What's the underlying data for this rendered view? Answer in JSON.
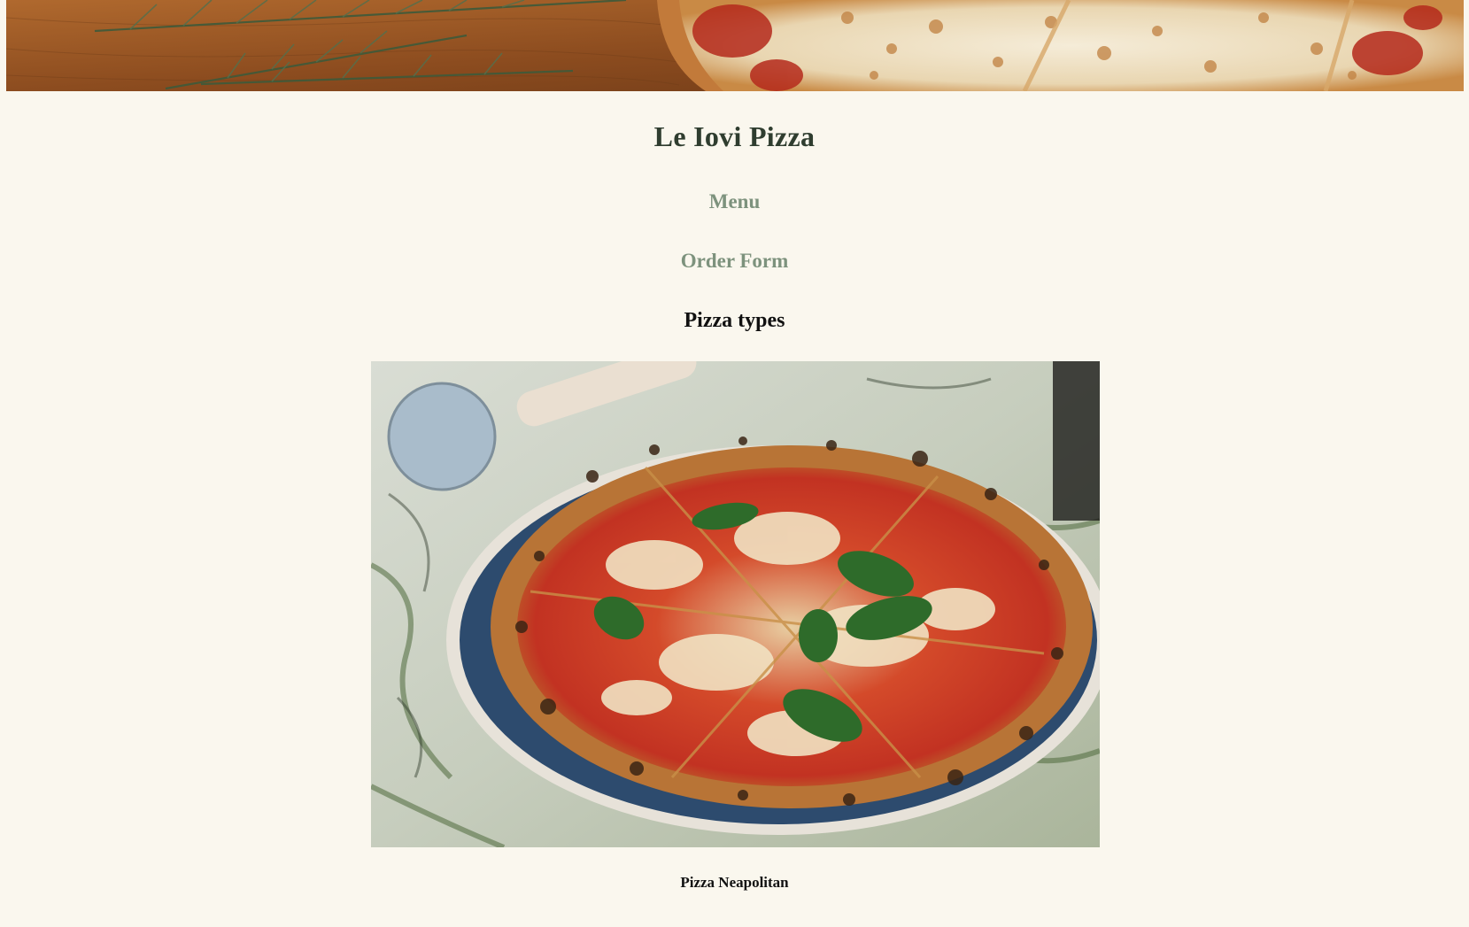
{
  "header": {
    "title": "Le Iovi Pizza"
  },
  "nav": {
    "menu_label": "Menu",
    "order_label": "Order Form"
  },
  "main": {
    "section_heading": "Pizza types",
    "items": [
      {
        "caption": "Pizza Neapolitan"
      }
    ]
  },
  "colors": {
    "background": "#faf7ee",
    "title": "#2f3d2f",
    "nav_link": "#7d927d"
  }
}
